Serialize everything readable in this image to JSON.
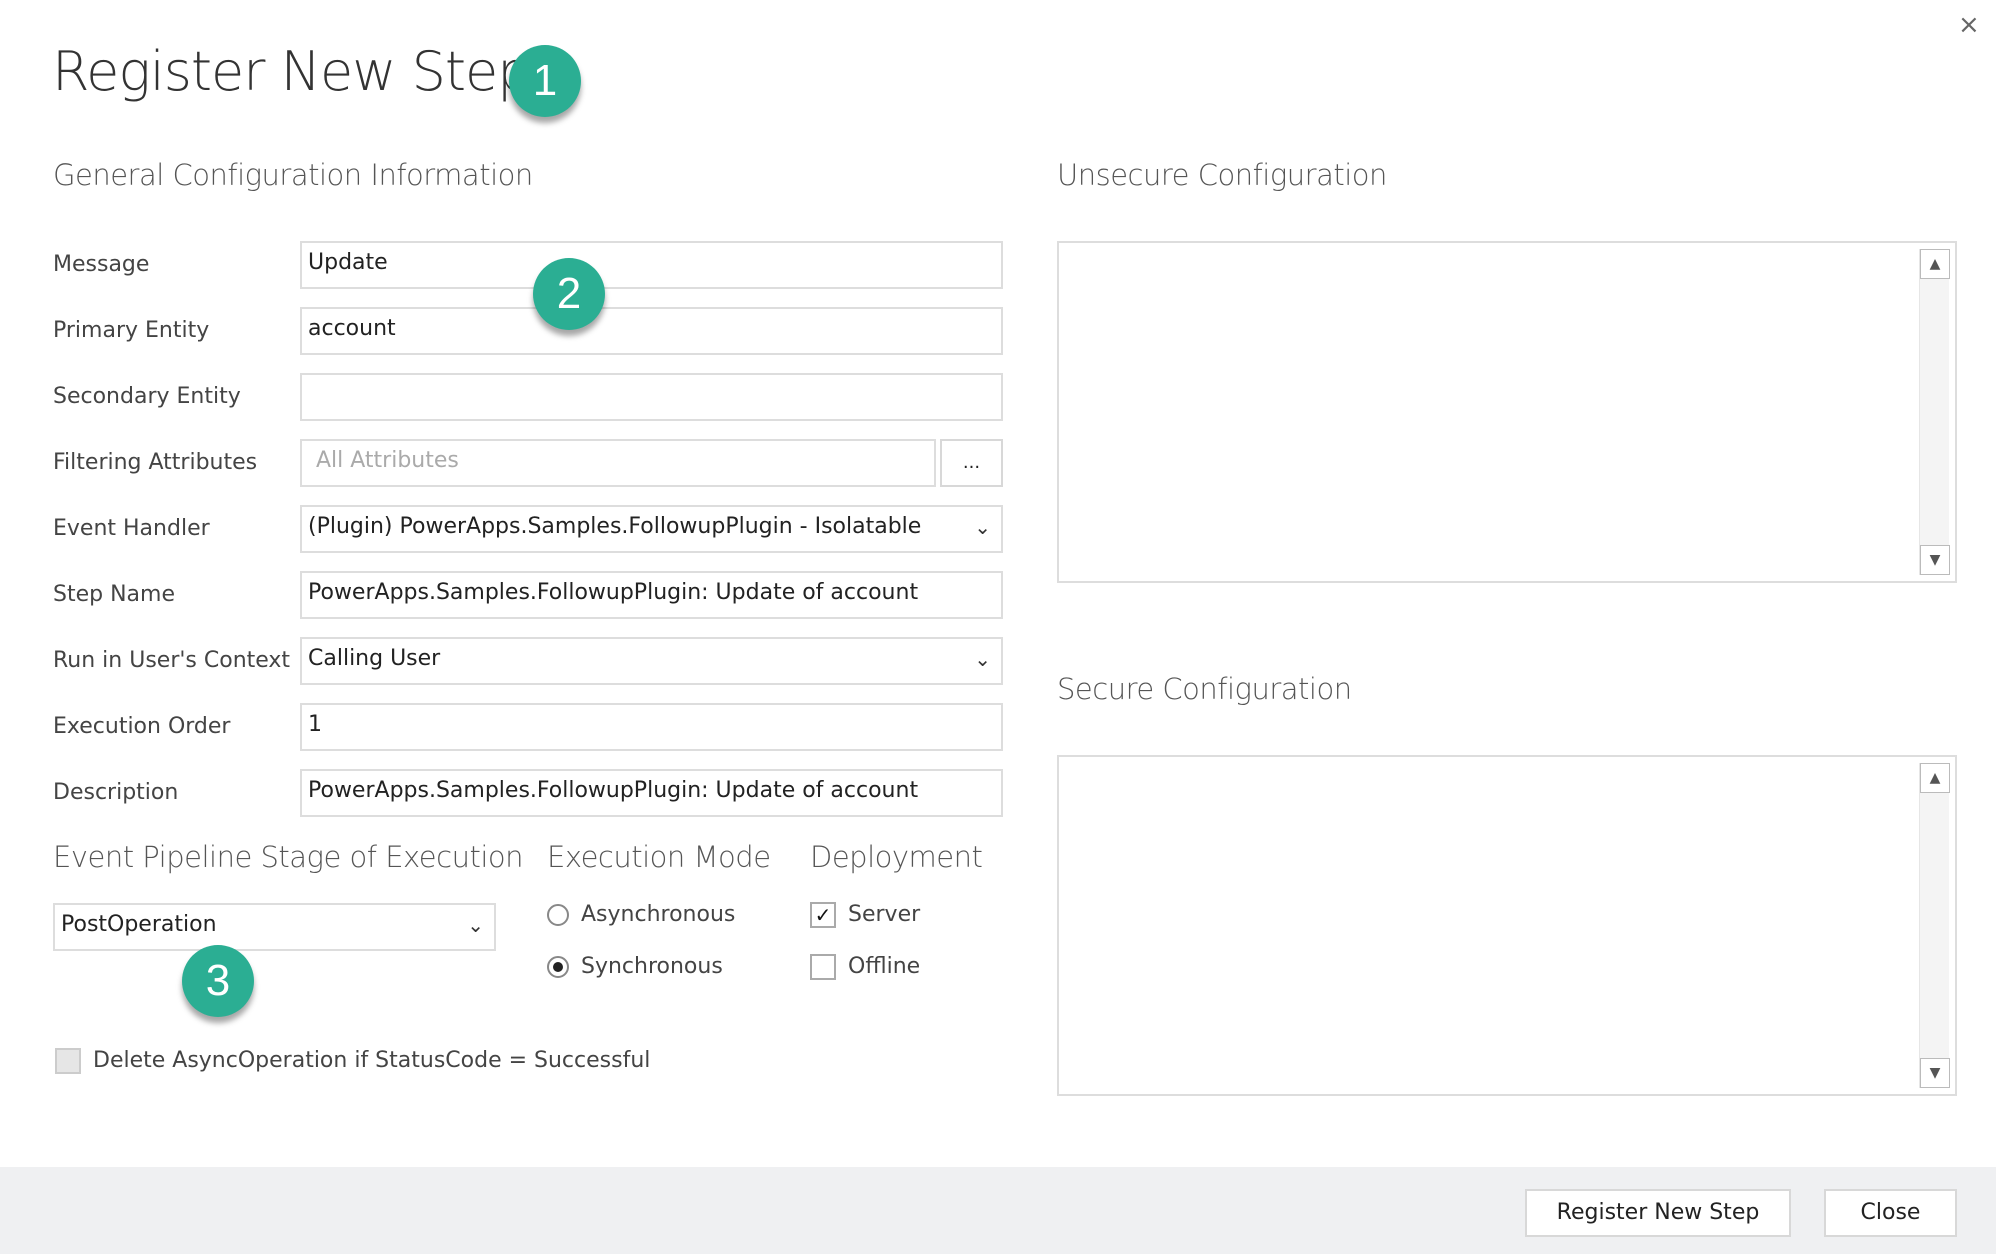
{
  "dialog": {
    "title": "Register New Step",
    "close_icon": "×"
  },
  "general": {
    "heading": "General Configuration Information",
    "fields": [
      {
        "label": "Message",
        "value": "Update"
      },
      {
        "label": "Primary Entity",
        "value": "account"
      },
      {
        "label": "Secondary Entity",
        "value": ""
      },
      {
        "label": "Filtering Attributes",
        "value": "",
        "placeholder": "All Attributes",
        "button": "..."
      },
      {
        "label": "Event Handler",
        "value": "(Plugin) PowerApps.Samples.FollowupPlugin - Isolatable"
      },
      {
        "label": "Step Name",
        "value": "PowerApps.Samples.FollowupPlugin: Update of account"
      },
      {
        "label": "Run in User's Context",
        "value": "Calling User"
      },
      {
        "label": "Execution Order",
        "value": "1"
      },
      {
        "label": "Description",
        "value": "PowerApps.Samples.FollowupPlugin: Update of account"
      }
    ]
  },
  "stage": {
    "heading": "Event Pipeline Stage of Execution",
    "value": "PostOperation"
  },
  "execution_mode": {
    "heading": "Execution Mode",
    "options": [
      {
        "label": "Asynchronous",
        "selected": false
      },
      {
        "label": "Synchronous",
        "selected": true
      }
    ]
  },
  "deployment": {
    "heading": "Deployment",
    "options": [
      {
        "label": "Server",
        "checked": true
      },
      {
        "label": "Offline",
        "checked": false
      }
    ]
  },
  "delete_async": {
    "label": "Delete AsyncOperation if StatusCode = Successful",
    "checked": false
  },
  "unsecure": {
    "heading": "Unsecure  Configuration",
    "value": ""
  },
  "secure": {
    "heading": "Secure  Configuration",
    "value": ""
  },
  "scroll": {
    "up": "▲",
    "down": "▼"
  },
  "chevron": "⌄",
  "checkmark": "✓",
  "badges": [
    "1",
    "2",
    "3"
  ],
  "badge_color": "#2bae93",
  "footer": {
    "register_label": "Register New Step",
    "close_label": "Close"
  }
}
